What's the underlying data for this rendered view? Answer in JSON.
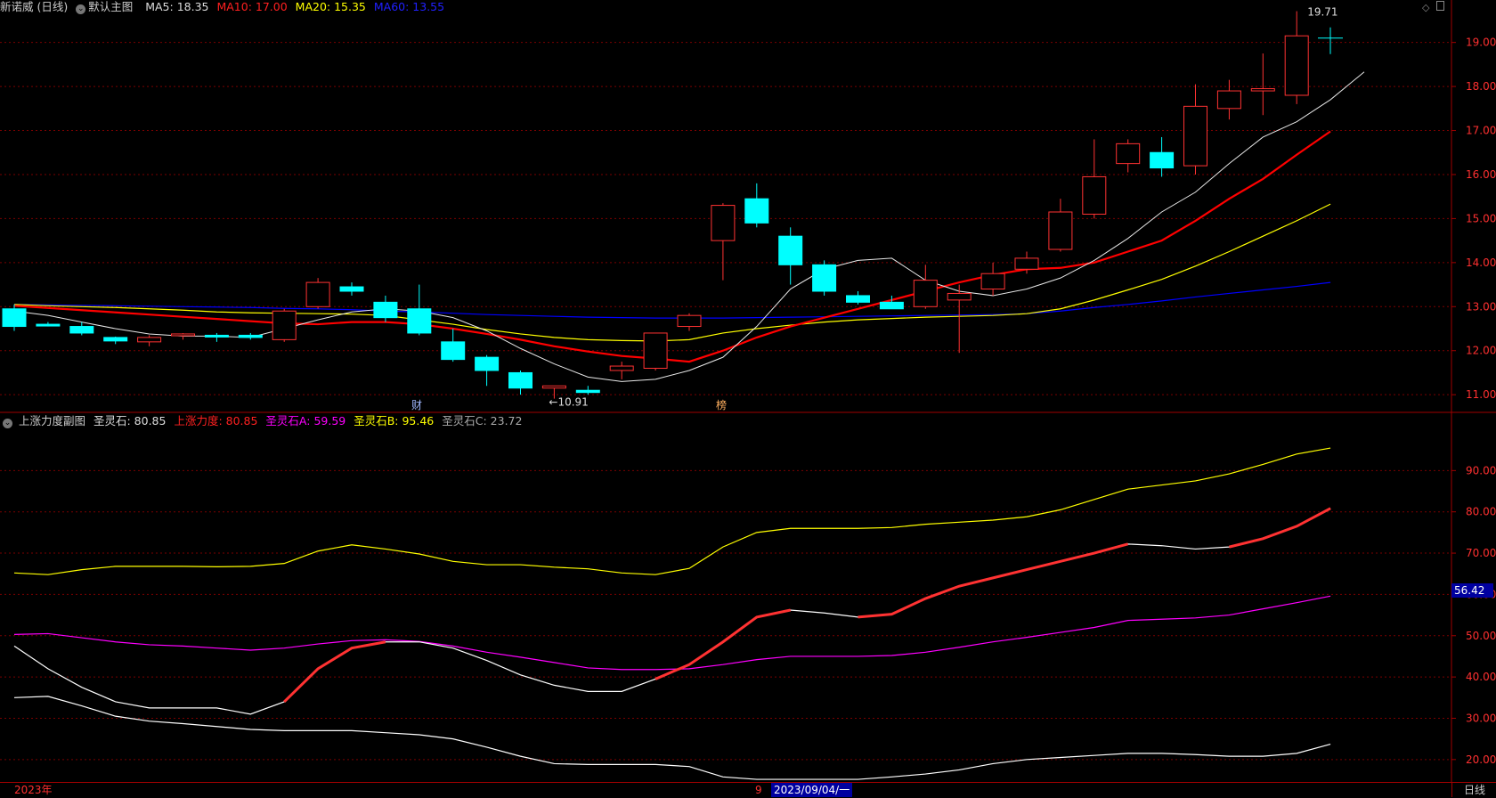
{
  "main_header": {
    "stock_name": "新诺威 (日线)",
    "template": "默认主图",
    "ma5": "MA5: 18.35",
    "ma10": "MA10: 17.00",
    "ma20": "MA20: 15.35",
    "ma60": "MA60: 13.55"
  },
  "sub_header": {
    "title": "上涨力度副图",
    "sls": "圣灵石: 80.85",
    "szld": "上涨力度: 80.85",
    "a": "圣灵石A: 59.59",
    "b": "圣灵石B: 95.46",
    "c": "圣灵石C: 23.72"
  },
  "footer": {
    "year": "2023年",
    "marker": "9",
    "cursor_date": "2023/09/04/一",
    "period_button": "日线"
  },
  "axis_cursor_value": "56.42",
  "colors": {
    "up": "#ff3232",
    "down": "#00ffff",
    "ma5": "#ffffff",
    "ma10": "#ff0000",
    "ma20": "#ffff00",
    "ma60": "#0000ff",
    "a": "#ff00ff",
    "b": "#ffff00",
    "c": "#ffffff",
    "frame": "#a00000"
  },
  "chart_data": [
    {
      "type": "candlestick",
      "ylim": [
        10.7,
        19.6
      ],
      "y_ticks": [
        11.0,
        12.0,
        13.0,
        14.0,
        15.0,
        16.0,
        17.0,
        18.0,
        19.0
      ],
      "candles": [
        {
          "o": 12.55,
          "h": 13.05,
          "l": 12.45,
          "c": 12.95,
          "dir": "down"
        },
        {
          "o": 12.6,
          "h": 12.65,
          "l": 12.55,
          "c": 12.58,
          "dir": "down"
        },
        {
          "o": 12.55,
          "h": 12.65,
          "l": 12.35,
          "c": 12.4,
          "dir": "down"
        },
        {
          "o": 12.3,
          "h": 12.32,
          "l": 12.15,
          "c": 12.22,
          "dir": "down"
        },
        {
          "o": 12.2,
          "h": 12.35,
          "l": 12.1,
          "c": 12.3,
          "dir": "up"
        },
        {
          "o": 12.35,
          "h": 12.4,
          "l": 12.25,
          "c": 12.38,
          "dir": "up"
        },
        {
          "o": 12.35,
          "h": 12.4,
          "l": 12.2,
          "c": 12.32,
          "dir": "down"
        },
        {
          "o": 12.35,
          "h": 12.4,
          "l": 12.25,
          "c": 12.3,
          "dir": "down"
        },
        {
          "o": 12.25,
          "h": 12.95,
          "l": 12.2,
          "c": 12.9,
          "dir": "up"
        },
        {
          "o": 13.0,
          "h": 13.65,
          "l": 12.95,
          "c": 13.55,
          "dir": "up"
        },
        {
          "o": 13.45,
          "h": 13.55,
          "l": 13.25,
          "c": 13.35,
          "dir": "down"
        },
        {
          "o": 13.1,
          "h": 13.25,
          "l": 12.65,
          "c": 12.75,
          "dir": "down"
        },
        {
          "o": 12.95,
          "h": 13.5,
          "l": 12.35,
          "c": 12.4,
          "dir": "down"
        },
        {
          "o": 12.2,
          "h": 12.5,
          "l": 11.75,
          "c": 11.8,
          "dir": "down"
        },
        {
          "o": 11.85,
          "h": 11.9,
          "l": 11.2,
          "c": 11.55,
          "dir": "down"
        },
        {
          "o": 11.5,
          "h": 11.55,
          "l": 11.0,
          "c": 11.15,
          "dir": "down"
        },
        {
          "o": 11.15,
          "h": 11.2,
          "l": 10.91,
          "c": 11.2,
          "dir": "up"
        },
        {
          "o": 11.1,
          "h": 11.2,
          "l": 11.0,
          "c": 11.05,
          "dir": "down"
        },
        {
          "o": 11.55,
          "h": 11.75,
          "l": 11.35,
          "c": 11.65,
          "dir": "up"
        },
        {
          "o": 11.6,
          "h": 12.4,
          "l": 11.55,
          "c": 12.4,
          "dir": "up"
        },
        {
          "o": 12.55,
          "h": 12.85,
          "l": 12.45,
          "c": 12.8,
          "dir": "up"
        },
        {
          "o": 14.5,
          "h": 15.35,
          "l": 13.6,
          "c": 15.3,
          "dir": "up"
        },
        {
          "o": 15.45,
          "h": 15.8,
          "l": 14.8,
          "c": 14.9,
          "dir": "down"
        },
        {
          "o": 14.6,
          "h": 14.8,
          "l": 13.5,
          "c": 13.95,
          "dir": "down"
        },
        {
          "o": 13.95,
          "h": 14.05,
          "l": 13.25,
          "c": 13.35,
          "dir": "down"
        },
        {
          "o": 13.25,
          "h": 13.35,
          "l": 13.05,
          "c": 13.1,
          "dir": "down"
        },
        {
          "o": 13.1,
          "h": 13.25,
          "l": 12.95,
          "c": 12.95,
          "dir": "down"
        },
        {
          "o": 13.0,
          "h": 13.95,
          "l": 12.95,
          "c": 13.6,
          "dir": "up"
        },
        {
          "o": 13.15,
          "h": 13.5,
          "l": 11.95,
          "c": 13.3,
          "dir": "up"
        },
        {
          "o": 13.4,
          "h": 14.0,
          "l": 13.25,
          "c": 13.75,
          "dir": "up"
        },
        {
          "o": 13.85,
          "h": 14.25,
          "l": 13.75,
          "c": 14.1,
          "dir": "up"
        },
        {
          "o": 14.3,
          "h": 15.45,
          "l": 14.25,
          "c": 15.15,
          "dir": "up"
        },
        {
          "o": 15.1,
          "h": 16.8,
          "l": 15.0,
          "c": 15.95,
          "dir": "up"
        },
        {
          "o": 16.25,
          "h": 16.8,
          "l": 16.05,
          "c": 16.7,
          "dir": "up"
        },
        {
          "o": 16.5,
          "h": 16.85,
          "l": 15.95,
          "c": 16.15,
          "dir": "down"
        },
        {
          "o": 16.2,
          "h": 18.05,
          "l": 16.0,
          "c": 17.55,
          "dir": "up"
        },
        {
          "o": 17.5,
          "h": 18.15,
          "l": 17.25,
          "c": 17.9,
          "dir": "up"
        },
        {
          "o": 17.9,
          "h": 18.75,
          "l": 17.35,
          "c": 17.95,
          "dir": "up"
        },
        {
          "o": 17.8,
          "h": 19.71,
          "l": 17.6,
          "c": 19.15,
          "dir": "up"
        }
      ],
      "ma5": [
        12.9,
        12.8,
        12.65,
        12.5,
        12.38,
        12.33,
        12.33,
        12.3,
        12.5,
        12.7,
        12.88,
        12.95,
        12.9,
        12.75,
        12.45,
        12.05,
        11.7,
        11.4,
        11.3,
        11.35,
        11.55,
        11.85,
        12.55,
        13.4,
        13.85,
        14.05,
        14.1,
        13.6,
        13.35,
        13.25,
        13.4,
        13.65,
        14.05,
        14.55,
        15.15,
        15.6,
        16.25,
        16.85,
        17.2,
        17.7,
        18.33
      ],
      "ma10": [
        13.02,
        12.97,
        12.92,
        12.87,
        12.82,
        12.77,
        12.72,
        12.67,
        12.62,
        12.6,
        12.65,
        12.65,
        12.6,
        12.5,
        12.38,
        12.25,
        12.1,
        11.98,
        11.88,
        11.82,
        11.75,
        12.0,
        12.3,
        12.55,
        12.75,
        12.95,
        13.15,
        13.35,
        13.55,
        13.72,
        13.85,
        13.88,
        14.0,
        14.25,
        14.5,
        14.95,
        15.45,
        15.9,
        16.45,
        16.98
      ],
      "ma20": [
        13.05,
        13.02,
        13.0,
        12.98,
        12.95,
        12.92,
        12.88,
        12.86,
        12.85,
        12.84,
        12.83,
        12.8,
        12.7,
        12.6,
        12.48,
        12.38,
        12.3,
        12.25,
        12.23,
        12.22,
        12.25,
        12.4,
        12.5,
        12.58,
        12.65,
        12.7,
        12.73,
        12.76,
        12.78,
        12.8,
        12.84,
        12.95,
        13.15,
        13.38,
        13.62,
        13.92,
        14.25,
        14.6,
        14.95,
        15.33
      ],
      "ma60": [
        13.05,
        13.04,
        13.03,
        13.02,
        13.01,
        13.0,
        12.99,
        12.98,
        12.96,
        12.95,
        12.93,
        12.9,
        12.88,
        12.85,
        12.82,
        12.8,
        12.78,
        12.76,
        12.75,
        12.74,
        12.74,
        12.74,
        12.75,
        12.76,
        12.77,
        12.78,
        12.79,
        12.8,
        12.81,
        12.82,
        12.84,
        12.9,
        12.98,
        13.05,
        13.13,
        13.22,
        13.3,
        13.38,
        13.46,
        13.55
      ],
      "annotations": {
        "high_label": "19.71",
        "low_label": "←10.91",
        "event1": "财",
        "event2": "榜"
      }
    },
    {
      "type": "line",
      "ylim": [
        15,
        100
      ],
      "y_ticks": [
        20.0,
        30.0,
        40.0,
        50.0,
        60.0,
        70.0,
        80.0,
        90.0
      ],
      "series": [
        {
          "name": "圣灵石A",
          "color": "#ff00ff",
          "values": [
            50.3,
            50.5,
            49.5,
            48.5,
            47.8,
            47.5,
            47.0,
            46.5,
            47.0,
            48.0,
            48.8,
            49.0,
            48.6,
            47.5,
            46.0,
            44.8,
            43.5,
            42.2,
            41.8,
            41.8,
            42.0,
            43.0,
            44.2,
            45.0,
            45.0,
            45.0,
            45.2,
            46.0,
            47.2,
            48.5,
            49.6,
            50.8,
            52.0,
            53.7,
            54.0,
            54.3,
            55.0,
            56.5,
            58.0,
            59.59
          ]
        },
        {
          "name": "圣灵石B",
          "color": "#ffff00",
          "values": [
            65.2,
            64.8,
            66.0,
            66.8,
            66.8,
            66.8,
            66.7,
            66.8,
            67.5,
            70.5,
            72.0,
            71.0,
            69.8,
            68.0,
            67.2,
            67.2,
            66.6,
            66.2,
            65.2,
            64.8,
            66.3,
            71.5,
            75.0,
            76.0,
            76.0,
            76.0,
            76.2,
            77.0,
            77.5,
            78.0,
            78.8,
            80.5,
            83.0,
            85.5,
            86.5,
            87.5,
            89.2,
            91.5,
            94.0,
            95.46
          ]
        },
        {
          "name": "圣灵石C",
          "color": "#ffffff",
          "values": [
            35.0,
            35.3,
            33.0,
            30.5,
            29.3,
            28.7,
            28.0,
            27.3,
            27.0,
            27.0,
            27.0,
            26.5,
            26.0,
            25.0,
            23.0,
            20.8,
            19.0,
            18.8,
            18.8,
            18.8,
            18.3,
            15.8,
            15.2,
            15.2,
            15.2,
            15.2,
            15.8,
            16.5,
            17.5,
            19.0,
            20.0,
            20.5,
            21.0,
            21.5,
            21.5,
            21.2,
            20.8,
            20.8,
            21.5,
            23.72
          ]
        },
        {
          "name": "圣灵石",
          "color": "#ffffff",
          "values": [
            47.5,
            42.0,
            37.5,
            34.0,
            32.5,
            32.5,
            32.5,
            31.0,
            34.0,
            42.0,
            47.0,
            48.5,
            48.5,
            47.0,
            44.0,
            40.5,
            38.0,
            36.5,
            36.5,
            39.5,
            43.0,
            48.5,
            54.5,
            56.2,
            55.5,
            54.5,
            55.2,
            59.0,
            62.0,
            64.0,
            66.0,
            68.0,
            70.0,
            72.2,
            71.8,
            71.0,
            71.5,
            73.5,
            76.5,
            80.85
          ]
        }
      ],
      "red_highlight_ranges": [
        [
          8,
          11
        ],
        [
          19,
          23
        ],
        [
          25,
          33
        ],
        [
          36,
          39
        ]
      ]
    }
  ]
}
